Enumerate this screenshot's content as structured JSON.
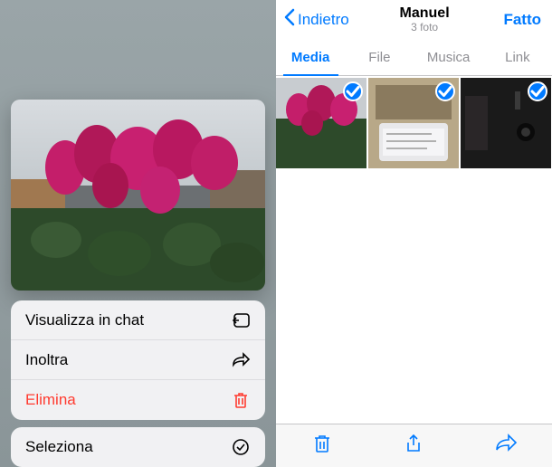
{
  "left": {
    "menu": {
      "view_in_chat": "Visualizza in chat",
      "forward": "Inoltra",
      "delete": "Elimina",
      "select": "Seleziona"
    },
    "icon_names": {
      "view_in_chat": "show-in-chat-icon",
      "forward": "forward-arrow-icon",
      "delete": "trash-icon",
      "select": "circle-check-icon"
    }
  },
  "right": {
    "back_label": "Indietro",
    "title": "Manuel",
    "subtitle": "3 foto",
    "done_label": "Fatto",
    "tabs": {
      "media": "Media",
      "file": "File",
      "music": "Musica",
      "link": "Link",
      "active": "media"
    },
    "selected_count": 3,
    "toolbar_icons": [
      "trash-icon",
      "share-icon",
      "forward-arrow-icon"
    ]
  }
}
